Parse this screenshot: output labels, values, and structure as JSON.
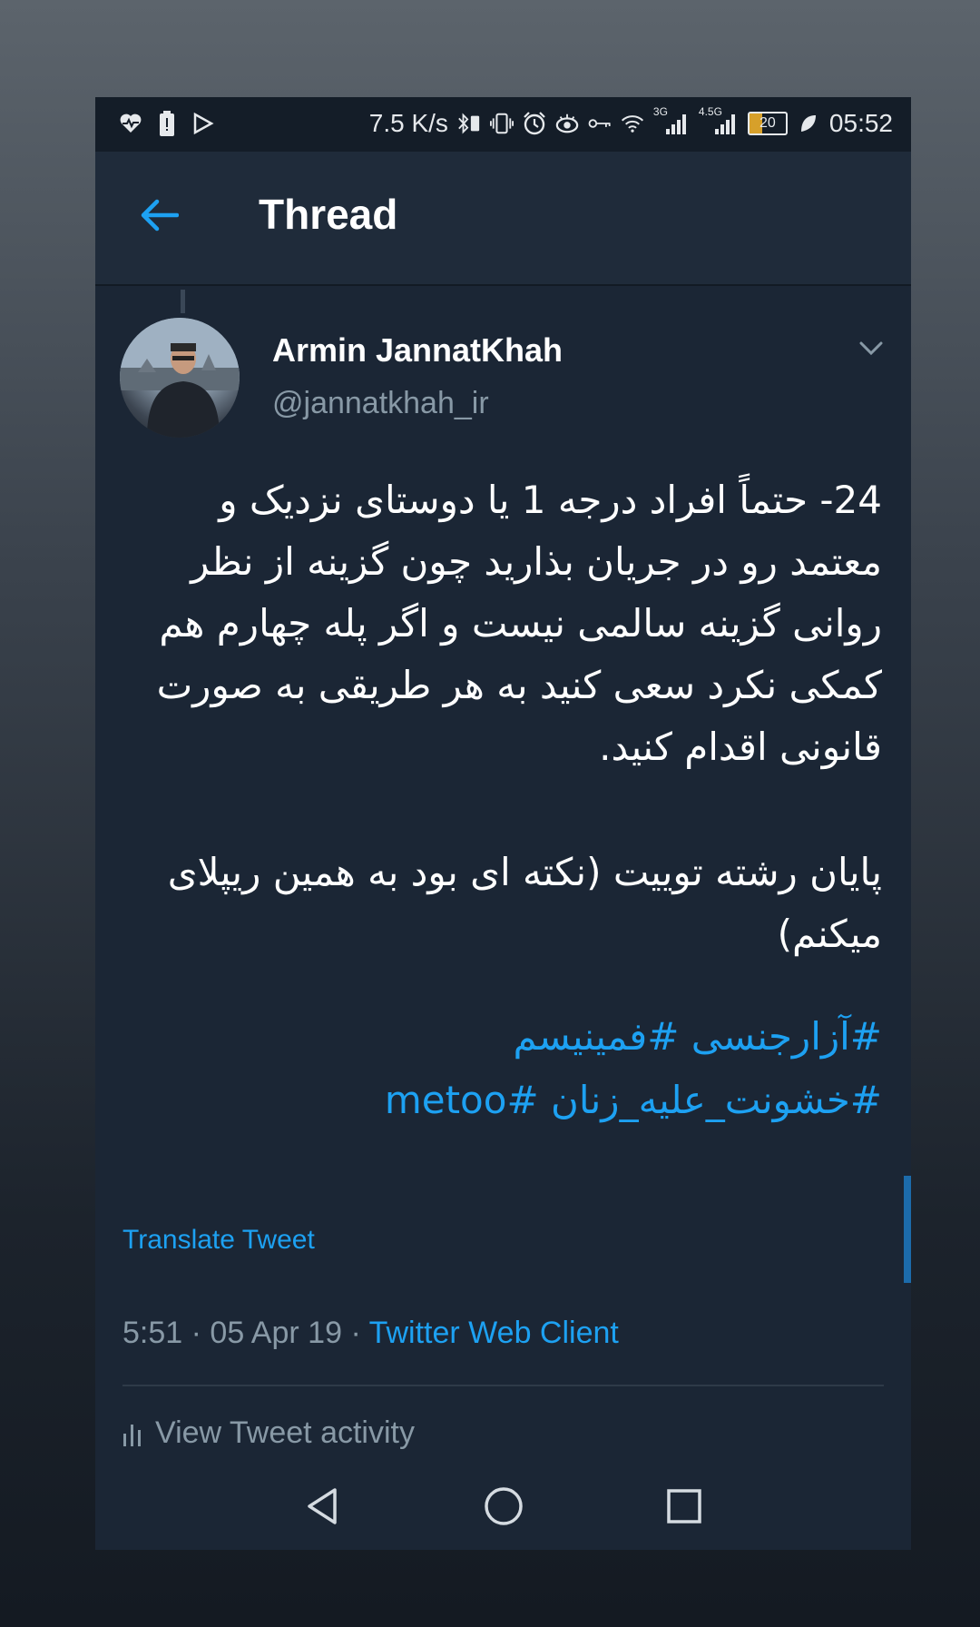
{
  "status_bar": {
    "net_speed": "7.5 K/s",
    "signal_1_label": "3G",
    "signal_2_label": "4.5G",
    "battery_level": "20",
    "time": "05:52",
    "icons": [
      "heart-rate-icon",
      "battery-alert-icon",
      "play-store-icon",
      "bluetooth-battery-icon",
      "vibrate-icon",
      "alarm-icon",
      "eye-icon",
      "key-icon",
      "wifi-icon",
      "leaf-icon"
    ]
  },
  "header": {
    "title": "Thread"
  },
  "tweet": {
    "author_name": "Armin JannatKhah",
    "author_handle": "@jannatkhah_ir",
    "paragraph_1": "24- حتماً افراد درجه 1 یا دوستای نزدیک و معتمد رو در جریان بذارید چون گزینه از نظر روانی گزینه سالمی نیست و اگر پله چهارم هم کمکی نکرد سعی کنید به هر طریقی به صورت قانونی اقدام کنید.",
    "paragraph_2": "پایان رشته توییت (نکته ای بود به همین ریپلای میکنم)",
    "hashtag_line_1": "#آزارجنسی #فمینیسم",
    "hashtag_line_2": "#خشونت_علیه_زنان #metoo",
    "translate_label": "Translate Tweet",
    "time": "5:51",
    "date": "05 Apr 19",
    "separator": "·",
    "client": "Twitter Web Client",
    "activity_label": "View Tweet activity"
  },
  "colors": {
    "background": "#1b2635",
    "accent": "#1da1f2",
    "muted": "#8899a6"
  }
}
